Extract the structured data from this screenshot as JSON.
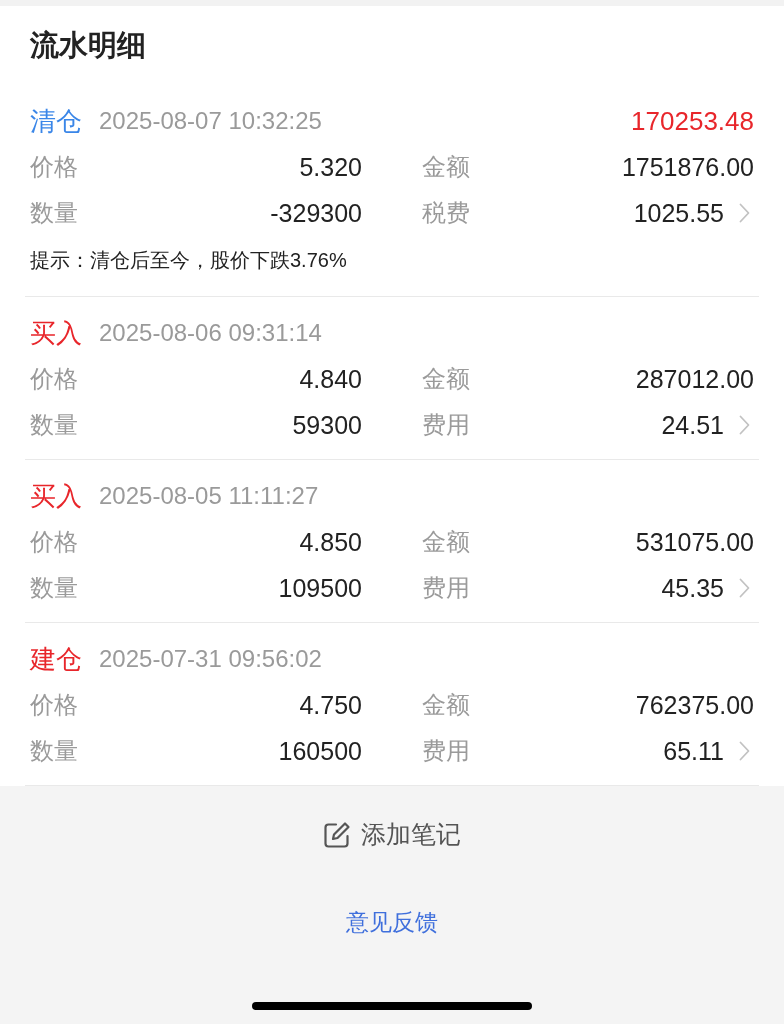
{
  "title": "流水明细",
  "records": [
    {
      "type": "清仓",
      "color": "#3a86e8",
      "time": "2025-08-07 10:32:25",
      "profit": "170253.48",
      "fields": [
        {
          "label": "价格",
          "value": "5.320"
        },
        {
          "label": "金额",
          "value": "1751876.00"
        },
        {
          "label": "数量",
          "value": "-329300"
        },
        {
          "label": "税费",
          "value": "1025.55"
        }
      ],
      "hint": "提示：清仓后至今，股价下跌3.76%"
    },
    {
      "type": "买入",
      "color": "#e8262b",
      "time": "2025-08-06 09:31:14",
      "fields": [
        {
          "label": "价格",
          "value": "4.840"
        },
        {
          "label": "金额",
          "value": "287012.00"
        },
        {
          "label": "数量",
          "value": "59300"
        },
        {
          "label": "费用",
          "value": "24.51"
        }
      ]
    },
    {
      "type": "买入",
      "color": "#e8262b",
      "time": "2025-08-05 11:11:27",
      "fields": [
        {
          "label": "价格",
          "value": "4.850"
        },
        {
          "label": "金额",
          "value": "531075.00"
        },
        {
          "label": "数量",
          "value": "109500"
        },
        {
          "label": "费用",
          "value": "45.35"
        }
      ]
    },
    {
      "type": "建仓",
      "color": "#e8262b",
      "time": "2025-07-31 09:56:02",
      "fields": [
        {
          "label": "价格",
          "value": "4.750"
        },
        {
          "label": "金额",
          "value": "762375.00"
        },
        {
          "label": "数量",
          "value": "160500"
        },
        {
          "label": "费用",
          "value": "65.11"
        }
      ]
    }
  ],
  "actions": {
    "note": "添加笔记",
    "feedback": "意见反馈"
  }
}
